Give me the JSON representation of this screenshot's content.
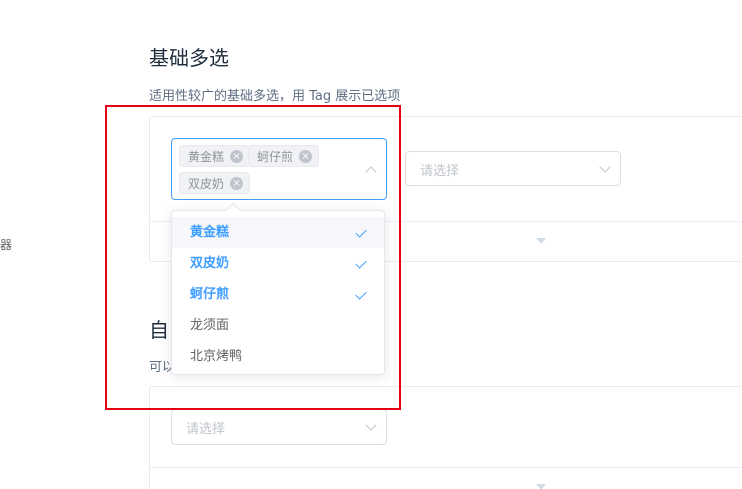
{
  "sidebar": {
    "cut_label": "器"
  },
  "section1": {
    "title": "基础多选",
    "description": "适用性较广的基础多选，用 Tag 展示已选项",
    "multi_select": {
      "tags": [
        {
          "label": "黄金糕"
        },
        {
          "label": "蚵仔煎"
        },
        {
          "label": "双皮奶"
        }
      ]
    },
    "second_select": {
      "placeholder": "请选择"
    },
    "dropdown": {
      "options": [
        {
          "label": "黄金糕",
          "selected": true
        },
        {
          "label": "双皮奶",
          "selected": true
        },
        {
          "label": "蚵仔煎",
          "selected": true
        },
        {
          "label": "龙须面",
          "selected": false
        },
        {
          "label": "北京烤鸭",
          "selected": false
        }
      ]
    }
  },
  "section2": {
    "title_partial": "自",
    "description_partial": "可以",
    "select": {
      "placeholder": "请选择"
    }
  },
  "colors": {
    "accent": "#409eff",
    "annotation": "#e60012",
    "tag_bg": "#f0f2f5"
  },
  "icons": {
    "tag_close": "circle-close-icon",
    "select_arrow": "chevron-icon",
    "option_check": "check-icon"
  }
}
